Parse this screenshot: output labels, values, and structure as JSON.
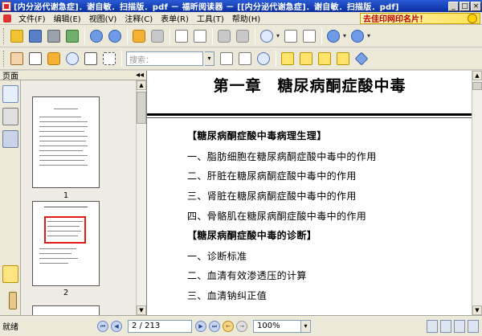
{
  "window": {
    "title": "[内分泌代谢急症]．谢自敏．扫描版．pdf － 福昕阅读器 － [[内分泌代谢急症]．谢自敏．扫描版．pdf]",
    "min_label": "_",
    "max_label": "□",
    "close_label": "×"
  },
  "menu": {
    "items": [
      "文件(F)",
      "编辑(E)",
      "视图(V)",
      "注释(C)",
      "表单(R)",
      "工具(T)",
      "帮助(H)"
    ],
    "banner_text": "去佳印网印名片！"
  },
  "toolbar": {
    "search_placeholder": "搜索："
  },
  "sidebar": {
    "header": "页面",
    "collapse_label": "◂◂",
    "thumbnails": [
      {
        "label": "1"
      },
      {
        "label": "2"
      }
    ]
  },
  "document": {
    "title": "第一章　糖尿病酮症酸中毒",
    "lines": [
      "【糖尿病酮症酸中毒病理生理】",
      "一、脂肪细胞在糖尿病酮症酸中毒中的作用",
      "二、肝脏在糖尿病酮症酸中毒中的作用",
      "三、肾脏在糖尿病酮症酸中毒中的作用",
      "四、骨骼肌在糖尿病酮症酸中毒中的作用",
      "【糖尿病酮症酸中毒的诊断】",
      "一、诊断标准",
      "二、血清有效渗透压的计算",
      "三、血清钠纠正值"
    ]
  },
  "statusbar": {
    "status": "就绪",
    "page_indicator": "2 / 213",
    "zoom": "100%"
  }
}
